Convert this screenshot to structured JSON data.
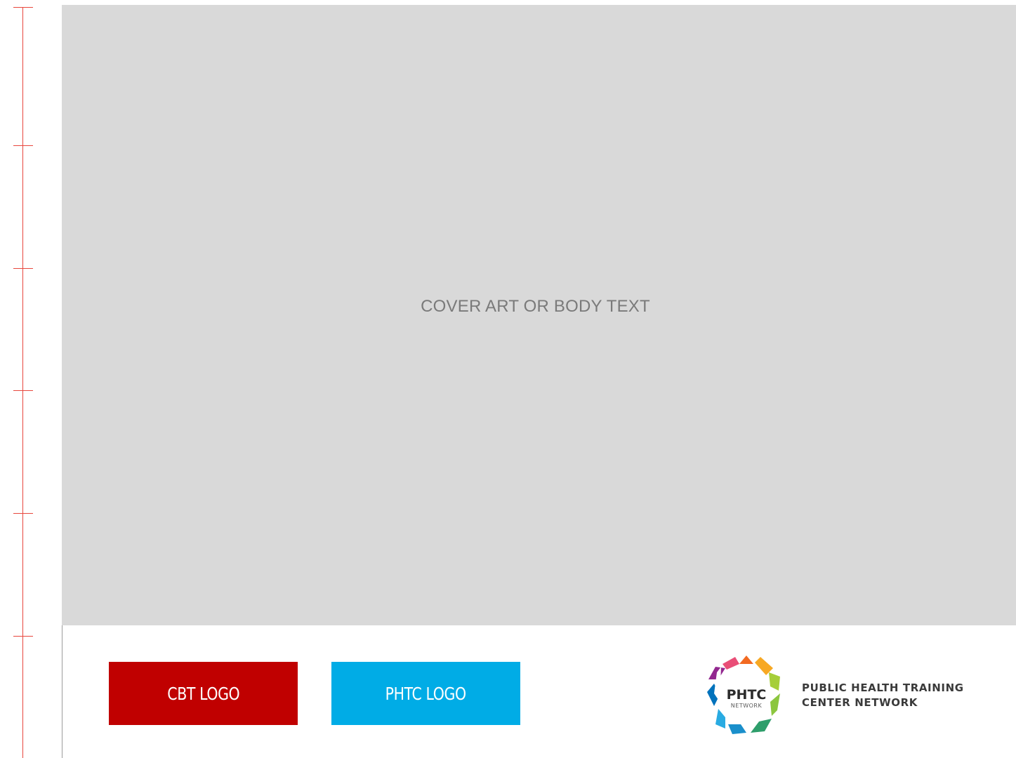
{
  "cover": {
    "placeholder_text": "COVER ART OR BODY TEXT"
  },
  "logos": {
    "cbt_label": "CBT LOGO",
    "phtc_label": "PHTC LOGO"
  },
  "network_logo": {
    "mark_text": "PHTC",
    "mark_subtext": "NETWORK",
    "name_line1": "PUBLIC HEALTH TRAINING",
    "name_line2": "CENTER NETWORK"
  },
  "colors": {
    "ruler": "#e8473d",
    "cover_bg": "#d9d9d9",
    "cbt_red": "#c00000",
    "phtc_blue": "#00ace6"
  }
}
